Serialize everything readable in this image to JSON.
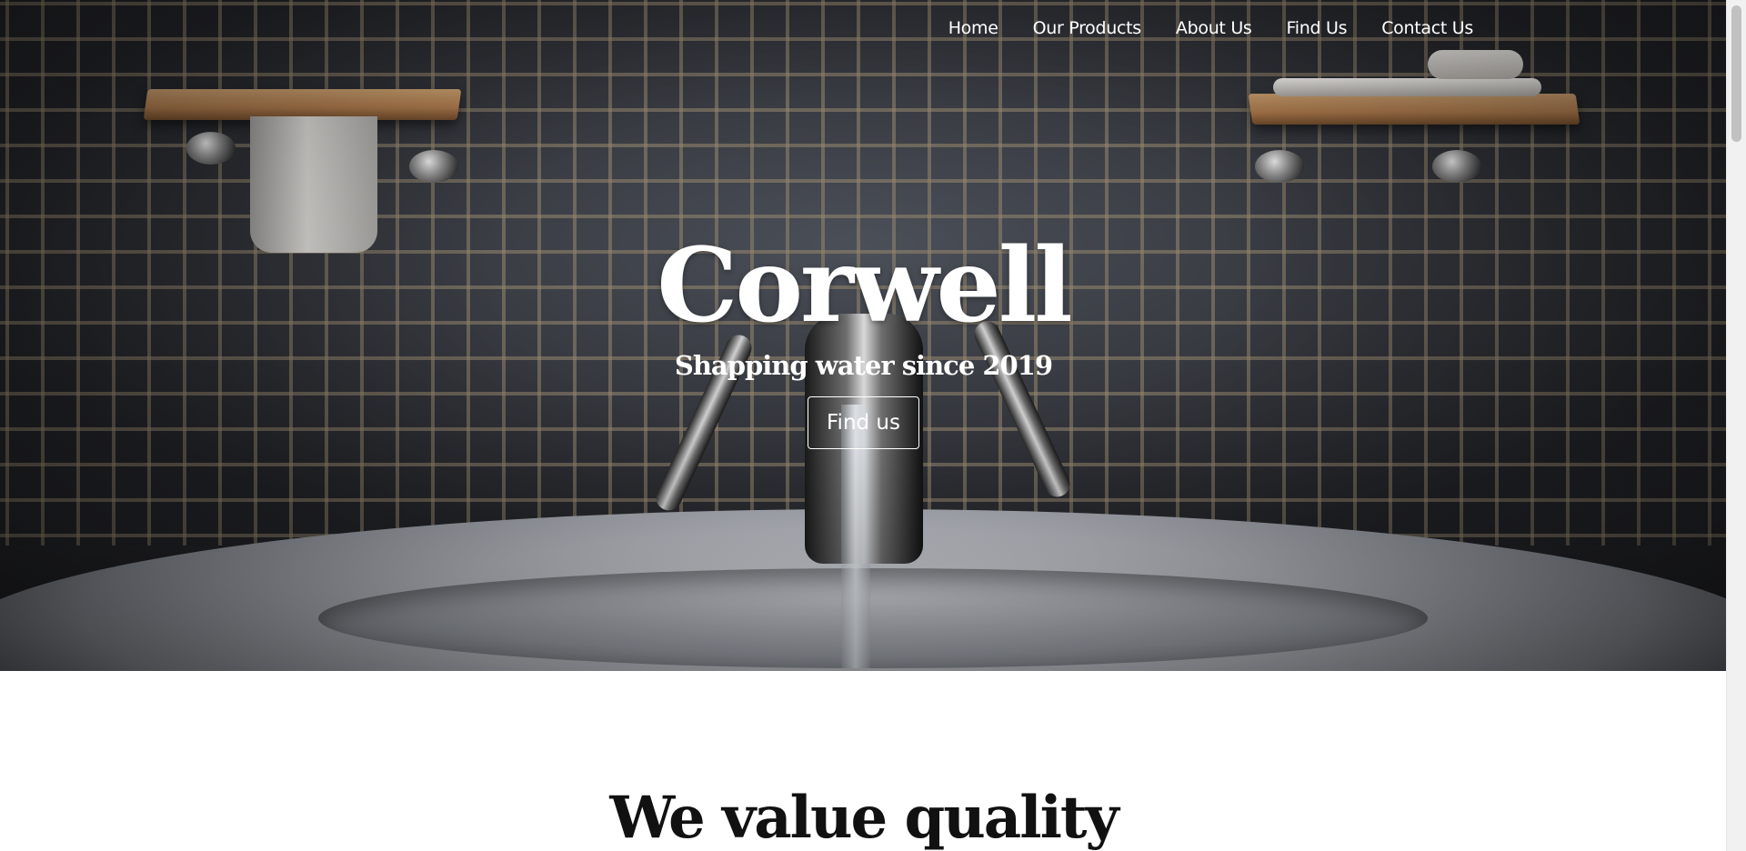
{
  "nav": {
    "items": [
      {
        "label": "Home"
      },
      {
        "label": "Our Products"
      },
      {
        "label": "About Us"
      },
      {
        "label": "Find Us"
      },
      {
        "label": "Contact Us"
      }
    ]
  },
  "hero": {
    "title": "Corwell",
    "tagline": "Shapping water since 2019",
    "cta_label": "Find us"
  },
  "section": {
    "title": "We value quality"
  },
  "colors": {
    "text_light": "#ffffff",
    "text_dark": "#111111",
    "background": "#ffffff"
  }
}
